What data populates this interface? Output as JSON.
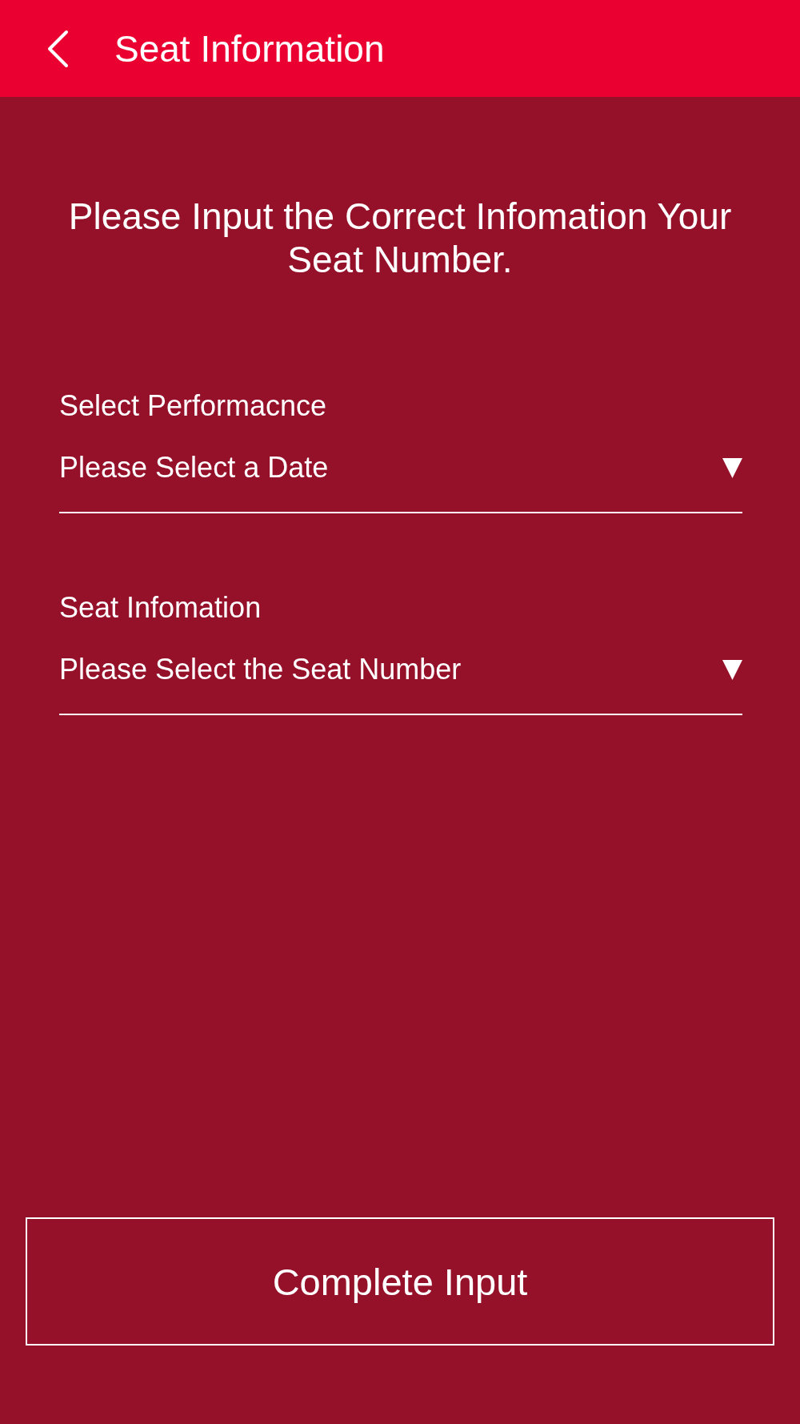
{
  "header": {
    "title": "Seat Information"
  },
  "instruction": "Please Input the Correct Infomation Your Seat Number.",
  "fields": [
    {
      "label": "Select Performacnce",
      "placeholder": "Please Select a Date"
    },
    {
      "label": "Seat Infomation",
      "placeholder": "Please Select the Seat Number"
    }
  ],
  "submit_button": {
    "label": "Complete Input"
  }
}
